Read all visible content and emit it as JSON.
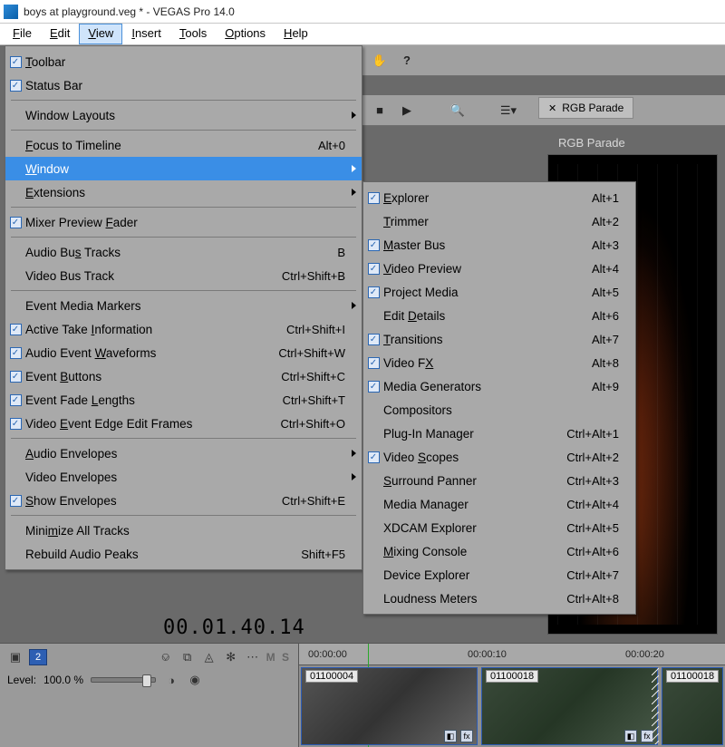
{
  "app": {
    "title": "boys at playground.veg * - VEGAS Pro 14.0"
  },
  "menubar": {
    "items": [
      {
        "label": "File",
        "mn": "F"
      },
      {
        "label": "Edit",
        "mn": "E"
      },
      {
        "label": "View",
        "mn": "V",
        "open": true
      },
      {
        "label": "Insert",
        "mn": "I"
      },
      {
        "label": "Tools",
        "mn": "T"
      },
      {
        "label": "Options",
        "mn": "O"
      },
      {
        "label": "Help",
        "mn": "H"
      }
    ]
  },
  "viewMenu": [
    {
      "type": "item",
      "label": "Toolbar",
      "mn": "T",
      "checked": true
    },
    {
      "type": "item",
      "label": "Status Bar",
      "mn": "",
      "checked": true
    },
    {
      "type": "sep"
    },
    {
      "type": "item",
      "label": "Window Layouts",
      "submenu": true
    },
    {
      "type": "sep"
    },
    {
      "type": "item",
      "label": "Focus to Timeline",
      "mn": "F",
      "accel": "Alt+0"
    },
    {
      "type": "item",
      "label": "Window",
      "mn": "W",
      "submenu": true,
      "highlight": true
    },
    {
      "type": "item",
      "label": "Extensions",
      "mn": "E",
      "submenu": true
    },
    {
      "type": "sep"
    },
    {
      "type": "item",
      "label": "Mixer Preview Fader",
      "mn": "F",
      "mnIndex": 14,
      "checked": true
    },
    {
      "type": "sep"
    },
    {
      "type": "item",
      "label": "Audio Bus Tracks",
      "mn": "s",
      "mnIndex": 8,
      "accel": "B"
    },
    {
      "type": "item",
      "label": "Video Bus Track",
      "mn": "",
      "accel": "Ctrl+Shift+B"
    },
    {
      "type": "sep"
    },
    {
      "type": "item",
      "label": "Event Media Markers",
      "mn": "",
      "submenu": true
    },
    {
      "type": "item",
      "label": "Active Take Information",
      "mn": "I",
      "mnIndex": 12,
      "checked": true,
      "accel": "Ctrl+Shift+I"
    },
    {
      "type": "item",
      "label": "Audio Event Waveforms",
      "mn": "W",
      "mnIndex": 12,
      "checked": true,
      "accel": "Ctrl+Shift+W"
    },
    {
      "type": "item",
      "label": "Event Buttons",
      "mn": "B",
      "mnIndex": 6,
      "checked": true,
      "accel": "Ctrl+Shift+C"
    },
    {
      "type": "item",
      "label": "Event Fade Lengths",
      "mn": "L",
      "mnIndex": 11,
      "checked": true,
      "accel": "Ctrl+Shift+T"
    },
    {
      "type": "item",
      "label": "Video Event Edge Edit Frames",
      "mn": "E",
      "mnIndex": 6,
      "checked": true,
      "accel": "Ctrl+Shift+O"
    },
    {
      "type": "sep"
    },
    {
      "type": "item",
      "label": "Audio Envelopes",
      "mn": "A",
      "submenu": true
    },
    {
      "type": "item",
      "label": "Video Envelopes",
      "mn": "",
      "submenu": true
    },
    {
      "type": "item",
      "label": "Show Envelopes",
      "mn": "S",
      "checked": true,
      "accel": "Ctrl+Shift+E"
    },
    {
      "type": "sep"
    },
    {
      "type": "item",
      "label": "Minimize All Tracks",
      "mn": "M",
      "mnIndex": 4
    },
    {
      "type": "item",
      "label": "Rebuild Audio Peaks",
      "mn": "",
      "accel": "Shift+F5"
    }
  ],
  "windowMenu": [
    {
      "label": "Explorer",
      "mn": "E",
      "checked": true,
      "accel": "Alt+1"
    },
    {
      "label": "Trimmer",
      "mn": "T",
      "accel": "Alt+2"
    },
    {
      "label": "Master Bus",
      "mn": "M",
      "checked": true,
      "accel": "Alt+3"
    },
    {
      "label": "Video Preview",
      "mn": "V",
      "checked": true,
      "accel": "Alt+4"
    },
    {
      "label": "Project Media",
      "mn": "",
      "checked": true,
      "accel": "Alt+5"
    },
    {
      "label": "Edit Details",
      "mn": "D",
      "mnIndex": 5,
      "accel": "Alt+6"
    },
    {
      "label": "Transitions",
      "mn": "T",
      "checked": true,
      "accel": "Alt+7"
    },
    {
      "label": "Video FX",
      "mn": "X",
      "mnIndex": 7,
      "checked": true,
      "accel": "Alt+8"
    },
    {
      "label": "Media Generators",
      "mn": "",
      "checked": true,
      "accel": "Alt+9"
    },
    {
      "label": "Compositors",
      "mn": ""
    },
    {
      "label": "Plug-In Manager",
      "mn": "",
      "accel": "Ctrl+Alt+1"
    },
    {
      "label": "Video Scopes",
      "mn": "S",
      "mnIndex": 6,
      "checked": true,
      "accel": "Ctrl+Alt+2"
    },
    {
      "label": "Surround Panner",
      "mn": "S",
      "accel": "Ctrl+Alt+3"
    },
    {
      "label": "Media Manager",
      "mn": "",
      "accel": "Ctrl+Alt+4"
    },
    {
      "label": "XDCAM Explorer",
      "mn": "",
      "accel": "Ctrl+Alt+5"
    },
    {
      "label": "Mixing Console",
      "mn": "M",
      "accel": "Ctrl+Alt+6"
    },
    {
      "label": "Device Explorer",
      "mn": "",
      "accel": "Ctrl+Alt+7"
    },
    {
      "label": "Loudness Meters",
      "mn": "",
      "accel": "Ctrl+Alt+8"
    }
  ],
  "panel": {
    "tab": "RGB Parade",
    "title": "RGB Parade"
  },
  "timeline": {
    "timecode": "00.01.40.14",
    "ruler": [
      "00:00:00",
      "00:00:10",
      "00:00:20"
    ],
    "track": {
      "number": "2",
      "levelLabel": "Level:",
      "level": "100.0 %",
      "ms": "M S"
    },
    "clips": [
      {
        "label": "01100004"
      },
      {
        "label": "01100018"
      },
      {
        "label": "01100018"
      }
    ]
  }
}
